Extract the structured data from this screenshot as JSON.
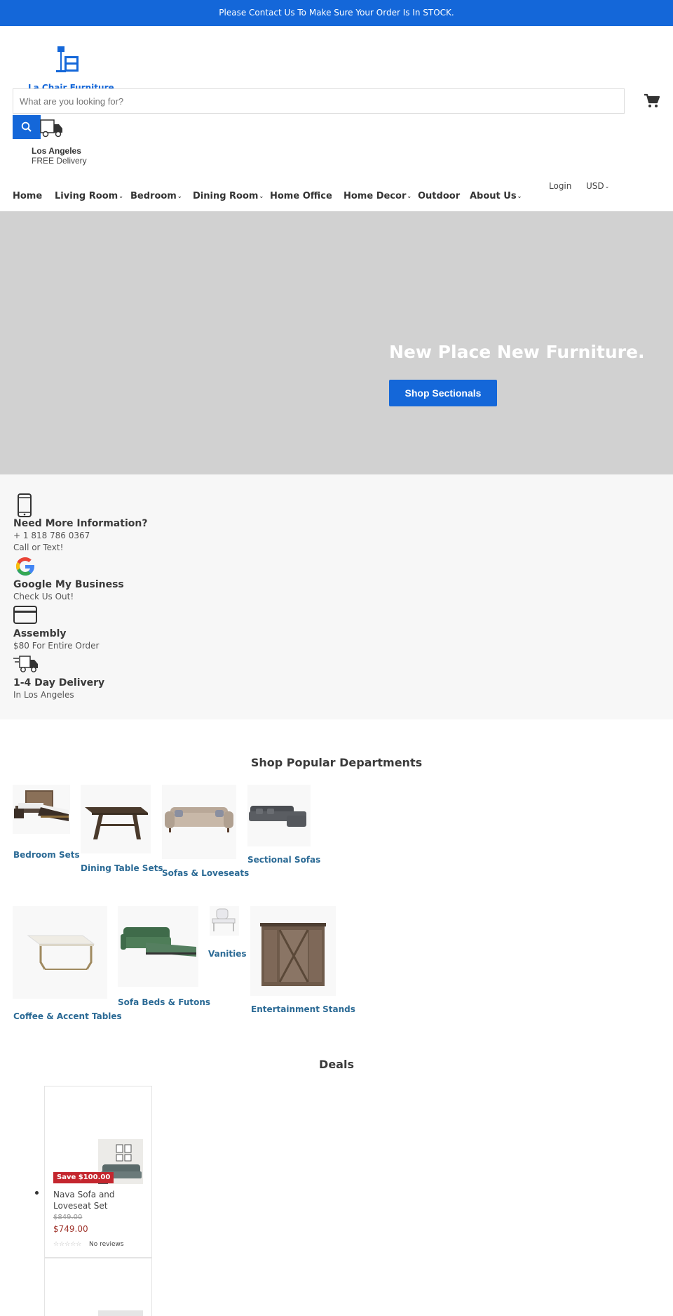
{
  "announcement": "Please Contact Us To Make Sure Your Order Is In STOCK.",
  "brand": {
    "logo_text": "La Chair Furniture",
    "accent": "#1467d9"
  },
  "search": {
    "placeholder": "What are you looking for?"
  },
  "location": {
    "city": "Los Angeles",
    "delivery": "FREE Delivery"
  },
  "account": {
    "login": "Login",
    "currency": "USD"
  },
  "nav": [
    {
      "label": "Home",
      "dropdown": false
    },
    {
      "label": "Living Room",
      "dropdown": true
    },
    {
      "label": "Bedroom",
      "dropdown": true
    },
    {
      "label": "Dining Room",
      "dropdown": true
    },
    {
      "label": "Home Office",
      "dropdown": false
    },
    {
      "label": "Home Decor",
      "dropdown": true
    },
    {
      "label": "Outdoor",
      "dropdown": false
    },
    {
      "label": "About Us",
      "dropdown": true
    }
  ],
  "hero": {
    "title": "New Place New Furniture.",
    "button": "Shop Sectionals",
    "background": "#d1d1d1"
  },
  "info": [
    {
      "icon": "phone-icon",
      "title": "Need More Information?",
      "lines": [
        "+ 1 818 786 0367",
        "Call or Text!"
      ]
    },
    {
      "icon": "google-icon",
      "title": "Google My Business",
      "lines": [
        "Check Us Out!"
      ]
    },
    {
      "icon": "credit-card-icon",
      "title": "Assembly",
      "lines": [
        "$80 For Entire Order"
      ]
    },
    {
      "icon": "delivery-truck-icon",
      "title": "1-4 Day Delivery",
      "lines": [
        "In Los Angeles"
      ]
    }
  ],
  "departments": {
    "title": "Shop Popular Departments",
    "items": [
      {
        "label": "Bedroom Sets",
        "icon": "bed-icon"
      },
      {
        "label": "Dining Table Sets",
        "icon": "dining-table-icon"
      },
      {
        "label": "Sofas & Loveseats",
        "icon": "sofa-icon"
      },
      {
        "label": "Sectional Sofas",
        "icon": "sectional-sofa-icon"
      },
      {
        "label": "Coffee & Accent Tables",
        "icon": "coffee-table-icon"
      },
      {
        "label": "Sofa Beds & Futons",
        "icon": "sofa-bed-icon"
      },
      {
        "label": "Vanities",
        "icon": "vanity-icon"
      },
      {
        "label": "Entertainment Stands",
        "icon": "tv-stand-icon"
      }
    ]
  },
  "deals": {
    "title": "Deals",
    "items": [
      {
        "badge": "Save $100.00",
        "name": "Nava Sofa and Loveseat Set",
        "compare_price": "$849.00",
        "price": "$749.00",
        "stars": "☆☆☆☆☆",
        "reviews": "No reviews"
      }
    ]
  }
}
